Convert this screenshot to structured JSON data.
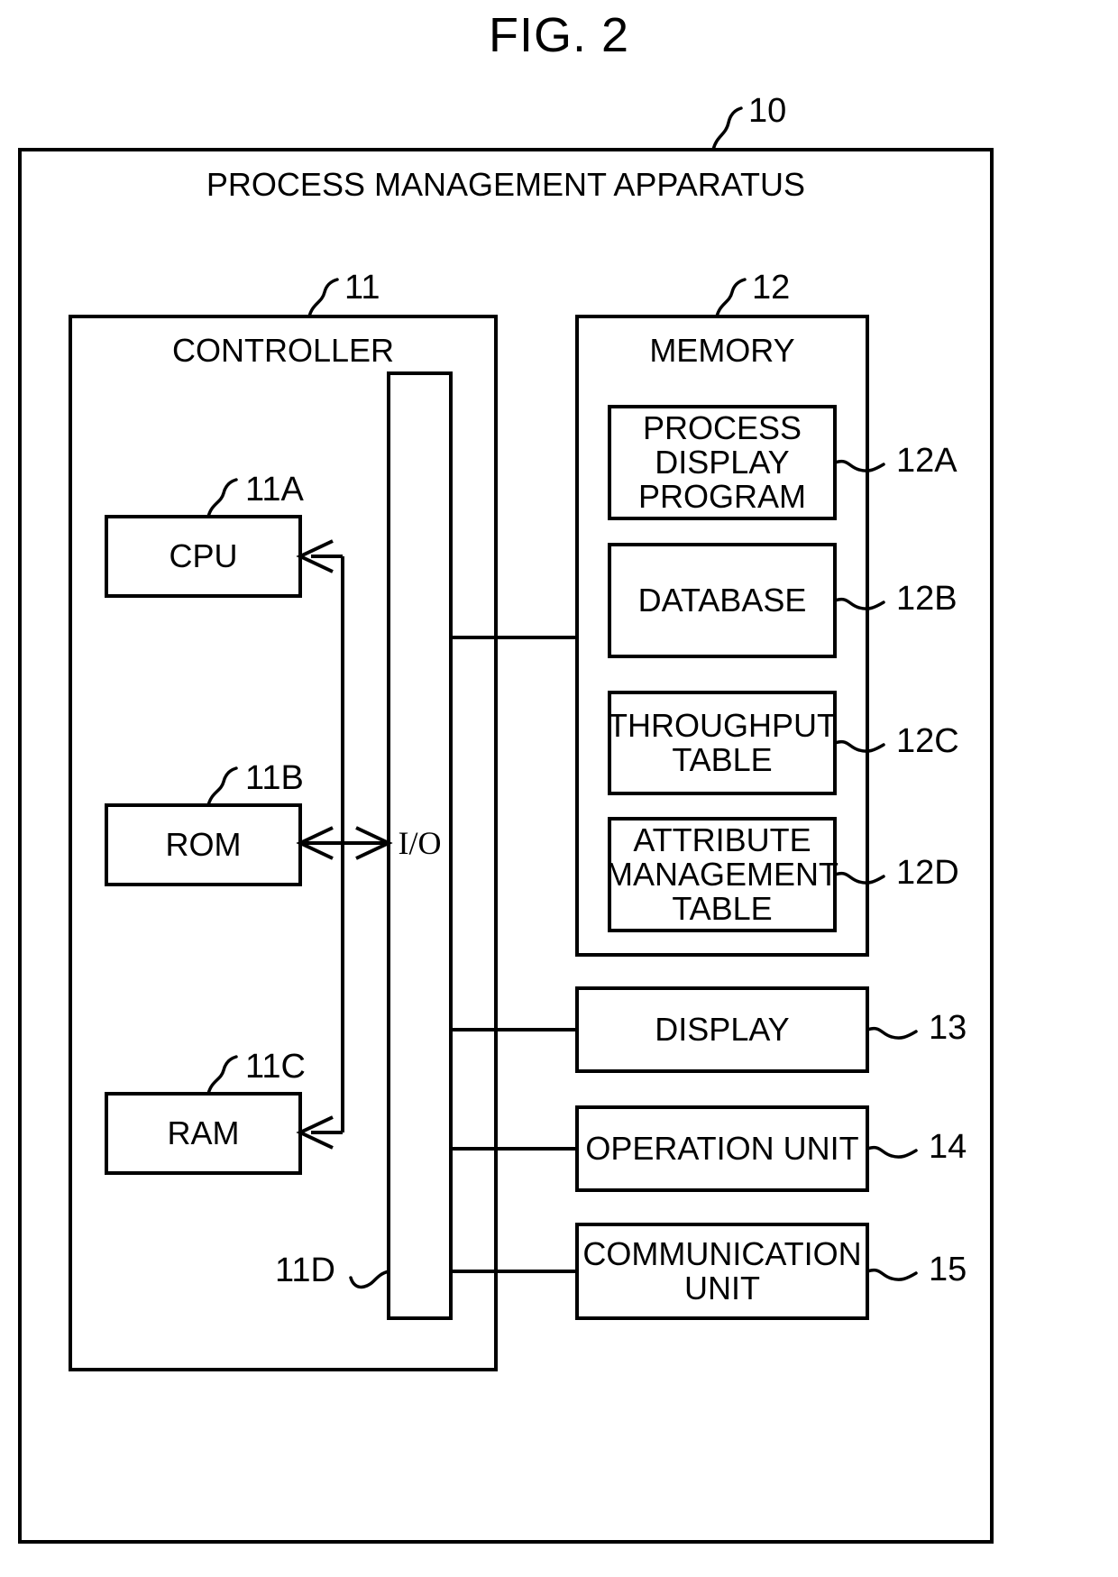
{
  "figure": {
    "title": "FIG. 2",
    "type": "patent-block-diagram"
  },
  "apparatus": {
    "title": "PROCESS MANAGEMENT APPARATUS",
    "ref": "10"
  },
  "controller": {
    "title": "CONTROLLER",
    "ref": "11",
    "components": [
      {
        "label": "CPU",
        "ref": "11A"
      },
      {
        "label": "ROM",
        "ref": "11B"
      },
      {
        "label": "RAM",
        "ref": "11C"
      }
    ],
    "io": {
      "label": "I/O",
      "ref": "11D"
    }
  },
  "memory": {
    "title": "MEMORY",
    "ref": "12",
    "items": [
      {
        "label": "PROCESS\nDISPLAY\nPROGRAM",
        "ref": "12A"
      },
      {
        "label": "DATABASE",
        "ref": "12B"
      },
      {
        "label": "THROUGHPUT\nTABLE",
        "ref": "12C"
      },
      {
        "label": "ATTRIBUTE\nMANAGEMENT\nTABLE",
        "ref": "12D"
      }
    ]
  },
  "peripherals": [
    {
      "label": "DISPLAY",
      "ref": "13"
    },
    {
      "label": "OPERATION UNIT",
      "ref": "14"
    },
    {
      "label": "COMMUNICATION\nUNIT",
      "ref": "15"
    }
  ],
  "colors": {
    "stroke": "#000000",
    "background": "#ffffff"
  }
}
